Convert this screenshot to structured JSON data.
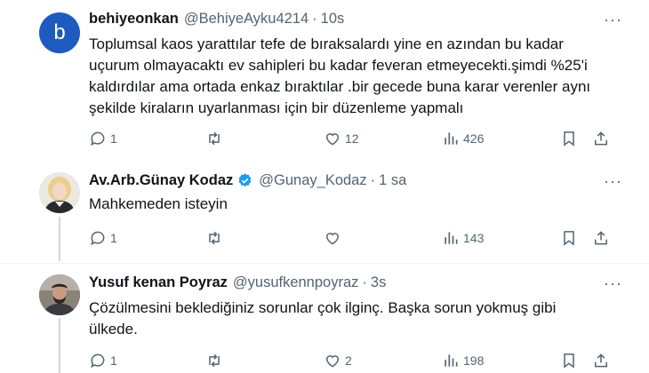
{
  "tweets": [
    {
      "avatar_letter": "b",
      "name": "behiyeonkan",
      "handle": "@BehiyeAyku4214",
      "separator": "·",
      "time": "10s",
      "more": "···",
      "text_lines": [
        "Toplumsal kaos yarattılar tefe de bıraksalardı yine en azından bu kadar",
        "uçurum olmayacaktı ev sahipleri bu kadar feveran etmeyecekti.şimdi %25'i",
        "kaldırdılar ama ortada enkaz bıraktılar .bir gecede buna karar verenler aynı",
        "şekilde kiraların uyarlanması için bir düzenleme yapmalı"
      ],
      "replies": "1",
      "retweets": "",
      "likes": "12",
      "views": "426"
    },
    {
      "name": "Av.Arb.Günay Kodaz",
      "verified": true,
      "handle": "@Gunay_Kodaz",
      "separator": "·",
      "time": "1 sa",
      "more": "···",
      "text_lines": [
        "Mahkemeden isteyin"
      ],
      "replies": "1",
      "retweets": "",
      "likes": "",
      "views": "143"
    },
    {
      "name": "Yusuf kenan Poyraz",
      "handle": "@yusufkennpoyraz",
      "separator": "·",
      "time": "3s",
      "more": "···",
      "text_lines": [
        "Çözülmesini beklediğiniz sorunlar çok ilginç. Başka sorun yokmuş gibi",
        "ülkede."
      ],
      "replies": "1",
      "retweets": "",
      "likes": "2",
      "views": "198"
    }
  ],
  "colors": {
    "verified": "#1d9bf0",
    "muted": "#536471",
    "text": "#0f1419",
    "avatar_b": "#1d5bbf"
  }
}
